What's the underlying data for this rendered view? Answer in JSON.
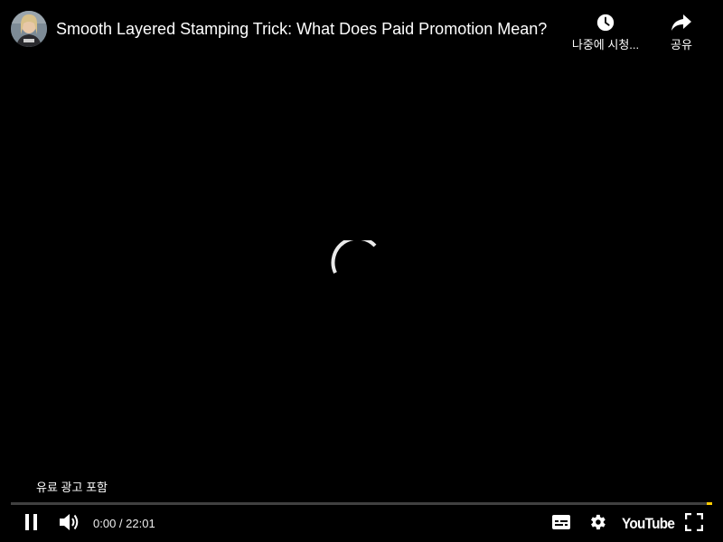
{
  "video": {
    "title": "Smooth Layered Stamping Trick: What Does Paid Promotion Mean?",
    "paid_promotion_label": "유료 광고 포함"
  },
  "top_actions": {
    "watch_later_label": "나중에 시청...",
    "watch_later_icon": "clock-icon",
    "share_label": "공유",
    "share_icon": "share-arrow-icon"
  },
  "player": {
    "state": "loading",
    "current_time": "0:00",
    "duration": "22:01",
    "time_display": "0:00 / 22:01",
    "progress_fraction": 0.0
  },
  "controls": {
    "play_pause_icon": "pause-icon",
    "volume_icon": "volume-icon",
    "subtitles_icon": "subtitles-icon",
    "settings_icon": "gear-icon",
    "logo_text": "YouTube",
    "fullscreen_icon": "fullscreen-icon"
  },
  "colors": {
    "background": "#000000",
    "text": "#ffffff",
    "ad_marker": "#ffcc00"
  }
}
